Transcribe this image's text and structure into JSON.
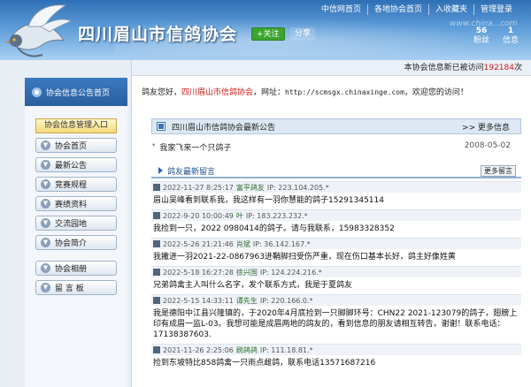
{
  "header": {
    "site_title": "四川眉山市信鸽协会",
    "follow_label": "+关注",
    "share_label": "分享",
    "nav": [
      "中信网首页",
      "各地协会首页",
      "入收藏夹",
      "管理登录"
    ],
    "stats": [
      {
        "num": "56",
        "label": "粉丝"
      },
      {
        "num": "1",
        "label": "信息"
      }
    ],
    "watermark": "www.china...com"
  },
  "sidebar": {
    "home_label": "协会信息公告首页",
    "manage_label": "协会信息管理入口",
    "items": [
      "协会首页",
      "最新公告",
      "竞赛规程",
      "赛绩资料",
      "交流园地",
      "协会简介",
      "协会相册",
      "留 言 板"
    ]
  },
  "main": {
    "visit_prefix": "本协会信息新已被访问",
    "visit_count": "192184",
    "visit_suffix": "次",
    "welcome_pre": "鸽友您好，",
    "welcome_assoc": "四川眉山市信鸽协会",
    "welcome_mid": "，网址：",
    "welcome_url": "http://scmsgx.chinaxinge.com",
    "welcome_post": "，欢迎您的访问！",
    "notice_title": "四川眉山市信鸽协会最新公告",
    "notice_more": ">> 更多信息",
    "notice_item": "我家飞来一个只鸽子",
    "notice_date": "2008-05-02",
    "msg_title": "鸽友最新留言",
    "msg_more": "更多留言"
  },
  "messages": [
    {
      "date": "2022-11-27 8:25:17",
      "name": "富平鸽友",
      "ip": "IP: 223.104.205.*",
      "body": "眉山吴峰看到联系我，我这样有一羽你慧能的鸽子15291345114"
    },
    {
      "date": "2022-9-20 10:00:49",
      "name": "叶",
      "ip": "IP: 183.223.232.*",
      "body": "我捡到一只，2022 0980414的鸽子。请与我联系，15983328352"
    },
    {
      "date": "2022-5-26 21:21:46",
      "name": "肖斌",
      "ip": "IP: 36.142.167.*",
      "body": "我撇进一羽2021-22-0867963进鞘脚扫受伤严重，现在伤口基本长好，鸽主好像姓黄"
    },
    {
      "date": "2022-5-18 16:27:28",
      "name": "徐兴国",
      "ip": "IP: 124.224.216.*",
      "body": "兄弟鸽禽主人叫什么名字，发个联系方式，我是于夏鸽友"
    },
    {
      "date": "2022-5-15 14:33:11",
      "name": "谭先生",
      "ip": "IP: 220.166.0.*",
      "body": "我是德阳中江县兴隆镇的，于2020年4月底捡到一只脚脚环号：CHN22 2021-123079的鸽子，翅膀上印有成眉一监L-03。我想可能是成眉两地的鸽友的，看到信息的朋友请相互转告，谢谢！联系电话：17138387603."
    },
    {
      "date": "2021-11-26 2:25:06",
      "name": "刷鸽鸽",
      "ip": "IP: 111.18.81.*",
      "body": "捡到东坡特比858鸽禽一只雨点雌鸽，联系电话13571687216"
    }
  ],
  "colors": {
    "accent": "#2f6fb5",
    "highlight": "#d21c1c",
    "follow": "#3aa52f"
  }
}
